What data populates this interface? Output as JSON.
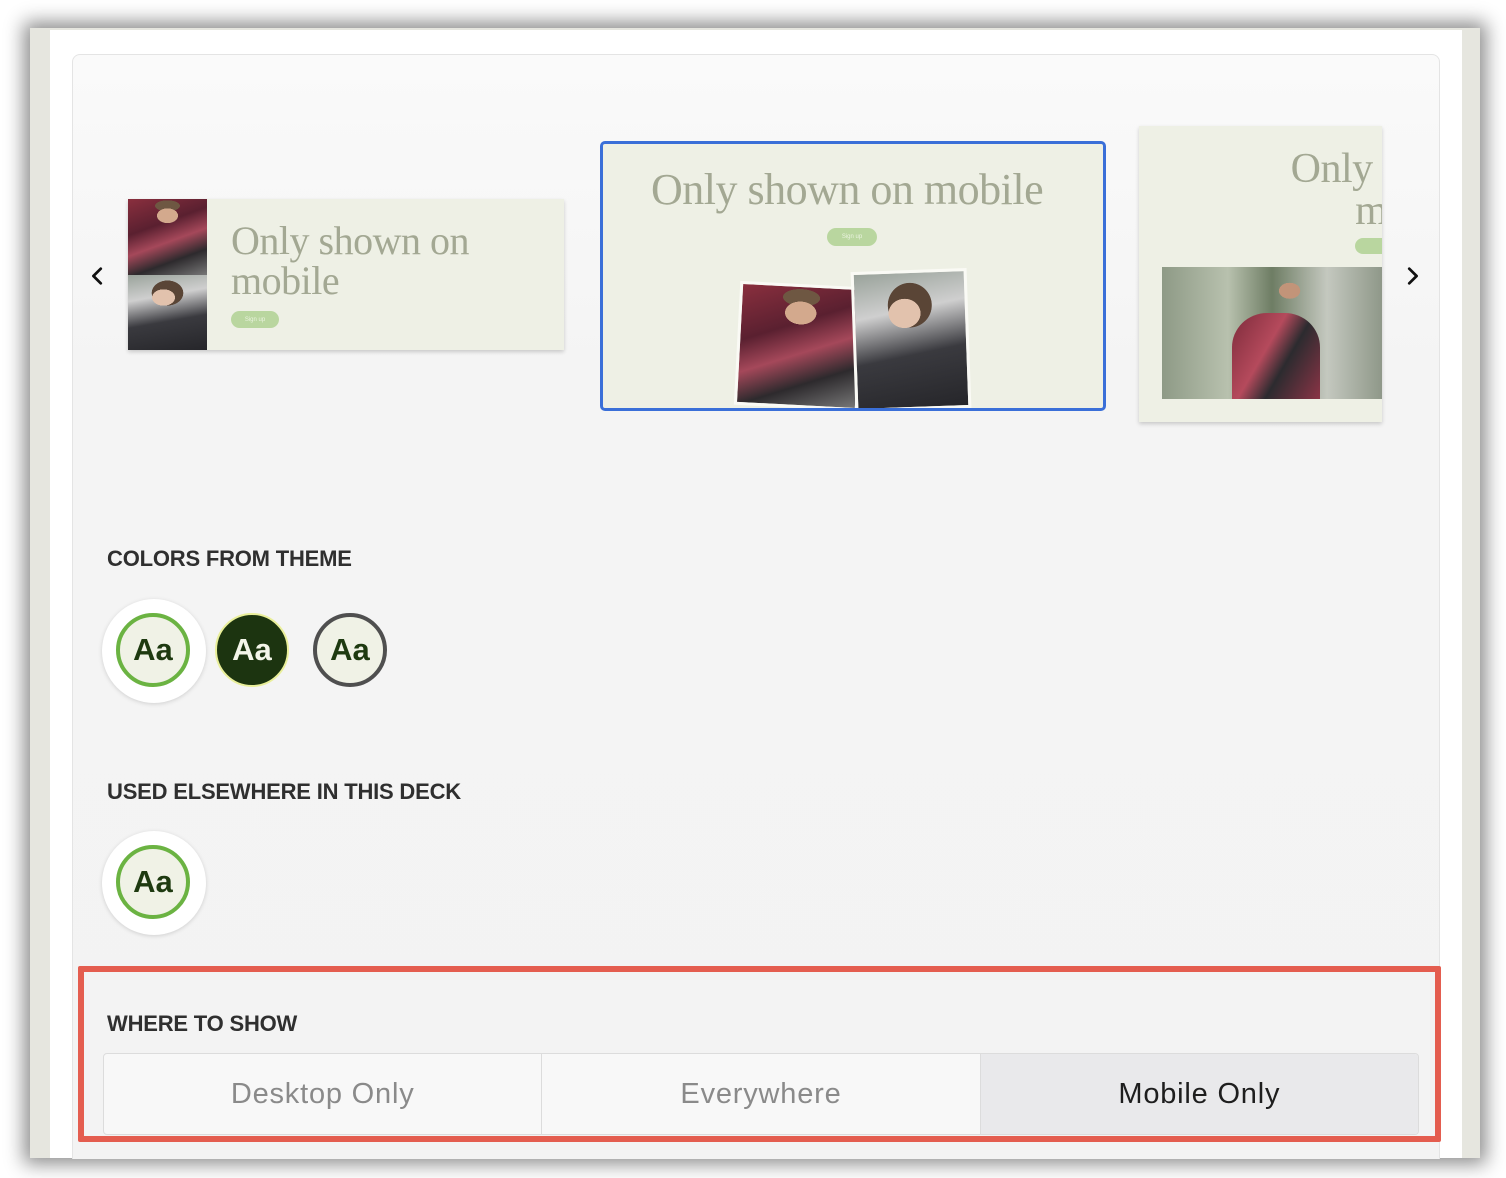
{
  "carousel": {
    "prev_icon": "chevron-left-icon",
    "next_icon": "chevron-right-icon",
    "slides": [
      {
        "title_line1": "Only shown on",
        "title_line2": "mobile",
        "button": "Sign up"
      },
      {
        "title": "Only shown on mobile",
        "button": "Sign up",
        "selected": true
      },
      {
        "title_line1": "Only sh",
        "title_line2": "mol"
      }
    ]
  },
  "colors_section": {
    "label": "COLORS FROM THEME",
    "swatches": [
      {
        "text": "Aa",
        "style": "light-green",
        "selected": true
      },
      {
        "text": "Aa",
        "style": "dark"
      },
      {
        "text": "Aa",
        "style": "light-gray"
      }
    ]
  },
  "used_section": {
    "label": "USED ELSEWHERE IN THIS DECK",
    "swatches": [
      {
        "text": "Aa",
        "style": "light-green",
        "selected": true
      }
    ]
  },
  "where_to_show": {
    "label": "WHERE TO SHOW",
    "options": [
      "Desktop Only",
      "Everywhere",
      "Mobile Only"
    ],
    "selected": "Mobile Only"
  },
  "colors": {
    "accent_green": "#6bb342",
    "dark_green": "#1c3410",
    "selection_blue": "#3a6fd8",
    "highlight_red": "#e45d4f"
  }
}
